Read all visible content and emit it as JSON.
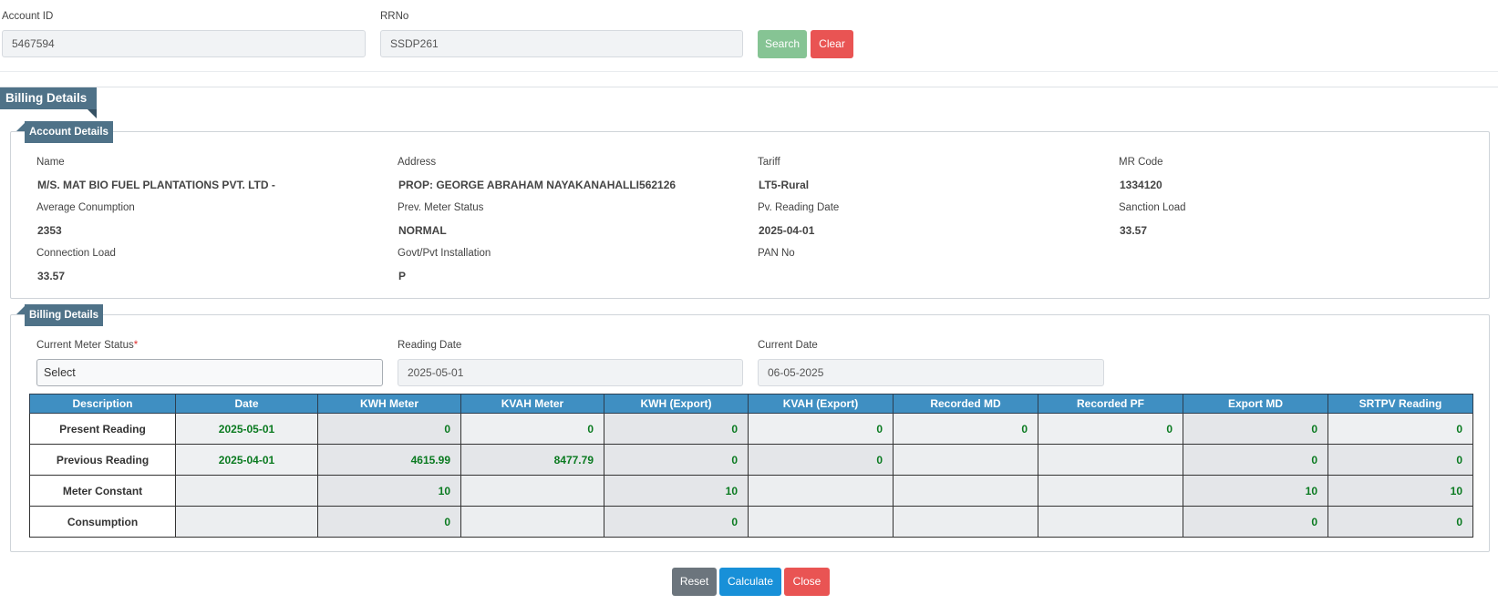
{
  "search": {
    "account_id_label": "Account ID",
    "account_id_value": "5467594",
    "rrno_label": "RRNo",
    "rrno_value": "SSDP261",
    "search_button": "Search",
    "clear_button": "Clear"
  },
  "page_title": "Billing Details",
  "account_details": {
    "title": "Account Details",
    "fields": [
      {
        "label": "Name",
        "value": "M/S. MAT BIO FUEL PLANTATIONS PVT. LTD -"
      },
      {
        "label": "Address",
        "value": "PROP: GEORGE ABRAHAM NAYAKANAHALLI562126"
      },
      {
        "label": "Tariff",
        "value": "LT5-Rural"
      },
      {
        "label": "MR Code",
        "value": "1334120"
      },
      {
        "label": "Average Conumption",
        "value": "2353"
      },
      {
        "label": "Prev. Meter Status",
        "value": "NORMAL"
      },
      {
        "label": "Pv. Reading Date",
        "value": "2025-04-01"
      },
      {
        "label": "Sanction Load",
        "value": "33.57"
      },
      {
        "label": "Connection Load",
        "value": "33.57"
      },
      {
        "label": "Govt/Pvt Installation",
        "value": "P"
      },
      {
        "label": "PAN No",
        "value": ""
      }
    ]
  },
  "billing_details": {
    "title": "Billing Details",
    "current_meter_status_label": "Current Meter Status",
    "required_mark": "*",
    "current_meter_status_value": "Select",
    "reading_date_label": "Reading Date",
    "reading_date_value": "2025-05-01",
    "current_date_label": "Current Date",
    "current_date_value": "06-05-2025",
    "table": {
      "headers": [
        "Description",
        "Date",
        "KWH Meter",
        "KVAH Meter",
        "KWH (Export)",
        "KVAH (Export)",
        "Recorded MD",
        "Recorded PF",
        "Export MD",
        "SRTPV Reading"
      ],
      "rows": [
        [
          "Present Reading",
          "2025-05-01",
          "0",
          "0",
          "0",
          "0",
          "0",
          "0",
          "0",
          "0"
        ],
        [
          "Previous Reading",
          "2025-04-01",
          "4615.99",
          "8477.79",
          "0",
          "0",
          "",
          "",
          "0",
          "0"
        ],
        [
          "Meter Constant",
          "",
          "10",
          "",
          "10",
          "",
          "",
          "",
          "10",
          "10"
        ],
        [
          "Consumption",
          "",
          "0",
          "",
          "0",
          "",
          "",
          "",
          "0",
          "0"
        ]
      ]
    }
  },
  "actions": {
    "reset": "Reset",
    "calculate": "Calculate",
    "close": "Close"
  }
}
